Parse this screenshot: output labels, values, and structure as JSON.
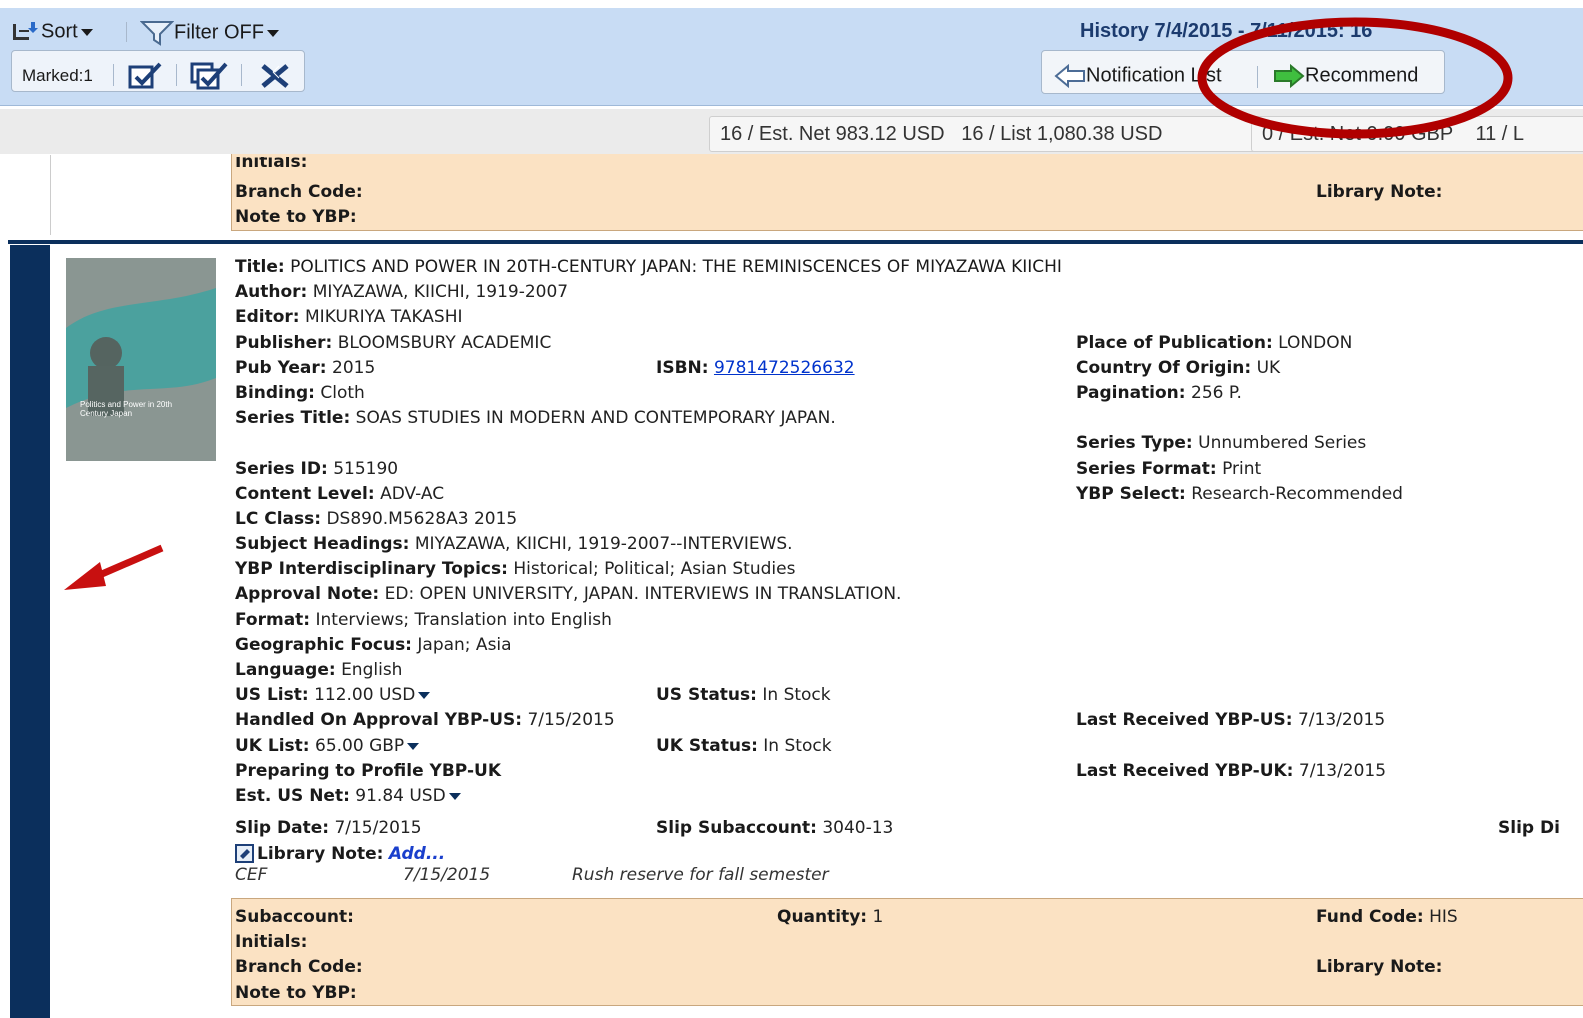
{
  "toolbar": {
    "sort_label": "Sort",
    "filter_label": "Filter OFF",
    "marked_label": "Marked:1",
    "history_label": "History 7/4/2015 - 7/11/2015: 16",
    "notification_list_label": "Notification List",
    "recommend_label": "Recommend"
  },
  "summary": {
    "usd_net": "16 / Est. Net  983.12 USD",
    "usd_list": "16 / List  1,080.38 USD",
    "gbp_net": "0 / Est. Net  0.00 GBP",
    "gbp_list": "11 / L"
  },
  "prev_record": {
    "initials_label": "Initials:",
    "branch_code_label": "Branch Code:",
    "library_note_label": "Library Note:",
    "note_to_ybp_label": "Note to YBP:"
  },
  "record": {
    "cover_title": "Politics and Power in 20th Century Japan",
    "title_label": "Title:",
    "title": "POLITICS AND POWER IN 20TH-CENTURY JAPAN: THE REMINISCENCES OF MIYAZAWA KIICHI",
    "author_label": "Author:",
    "author": "MIYAZAWA, KIICHI, 1919-2007",
    "editor_label": "Editor:",
    "editor": "MIKURIYA TAKASHI",
    "publisher_label": "Publisher:",
    "publisher": "BLOOMSBURY ACADEMIC",
    "place_label": "Place of Publication:",
    "place": "LONDON",
    "pub_year_label": "Pub Year:",
    "pub_year": "2015",
    "isbn_label": "ISBN:",
    "isbn": "9781472526632",
    "country_label": "Country Of Origin:",
    "country": "UK",
    "binding_label": "Binding:",
    "binding": "Cloth",
    "pagination_label": "Pagination:",
    "pagination": "256 P.",
    "series_title_label": "Series Title:",
    "series_title": "SOAS STUDIES IN MODERN AND CONTEMPORARY JAPAN.",
    "series_type_label": "Series Type:",
    "series_type": "Unnumbered Series",
    "series_id_label": "Series ID:",
    "series_id": "515190",
    "series_format_label": "Series Format:",
    "series_format": "Print",
    "content_level_label": "Content Level:",
    "content_level": "ADV-AC",
    "ybp_select_label": "YBP Select:",
    "ybp_select": "Research-Recommended",
    "lc_class_label": "LC Class:",
    "lc_class": "DS890.M5628A3 2015",
    "subject_label": "Subject Headings:",
    "subject": "MIYAZAWA, KIICHI, 1919-2007--INTERVIEWS.",
    "topics_label": "YBP Interdisciplinary Topics:",
    "topics": "Historical; Political; Asian Studies",
    "approval_note_label": "Approval Note:",
    "approval_note": "ED: OPEN UNIVERSITY, JAPAN. INTERVIEWS IN TRANSLATION.",
    "format_label": "Format:",
    "format": "Interviews; Translation into English",
    "geo_label": "Geographic Focus:",
    "geo": "Japan; Asia",
    "language_label": "Language:",
    "language": "English",
    "us_list_label": "US List:",
    "us_list": "112.00 USD",
    "us_status_label": "US Status:",
    "us_status": "In Stock",
    "handled_label": "Handled On Approval YBP-US:",
    "handled": "7/15/2015",
    "last_us_label": "Last Received YBP-US:",
    "last_us": "7/13/2015",
    "uk_list_label": "UK List:",
    "uk_list": "65.00 GBP",
    "uk_status_label": "UK Status:",
    "uk_status": "In Stock",
    "preparing_label": "Preparing to Profile YBP-UK",
    "last_uk_label": "Last Received YBP-UK:",
    "last_uk": "7/13/2015",
    "est_net_label": "Est. US Net:",
    "est_net": "91.84 USD",
    "slip_date_label": "Slip Date:",
    "slip_date": "7/15/2015",
    "slip_sub_label": "Slip Subaccount:",
    "slip_sub": "3040-13",
    "slip_di_label": "Slip Di",
    "library_note_label": "Library Note:",
    "library_note_add": "Add...",
    "note_initials": "CEF",
    "note_date": "7/15/2015",
    "note_text": "Rush reserve for fall semester"
  },
  "order": {
    "subaccount_label": "Subaccount:",
    "quantity_label": "Quantity:",
    "quantity": "1",
    "fund_code_label": "Fund Code:",
    "fund_code": "HIS",
    "initials_label": "Initials:",
    "branch_code_label": "Branch Code:",
    "library_note_label": "Library Note:",
    "note_to_ybp_label": "Note to YBP:"
  },
  "colors": {
    "accent_red": "#b00000",
    "navy": "#0b2f5c",
    "toolbar_bg": "#c8dcf4",
    "order_bg": "#fbe2c3"
  }
}
